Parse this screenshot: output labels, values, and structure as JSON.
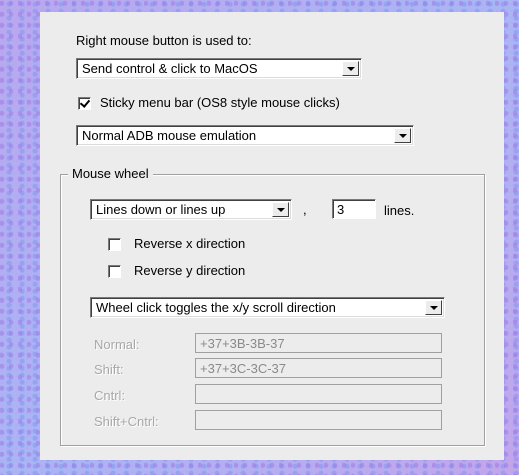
{
  "right_mouse": {
    "label": "Right mouse button is used to:",
    "selected": "Send control & click to MacOS"
  },
  "sticky_menu": {
    "checked": true,
    "label": "Sticky menu bar (OS8 style mouse clicks)"
  },
  "adb_emulation": {
    "selected": "Normal ADB mouse emulation"
  },
  "mouse_wheel": {
    "title": "Mouse wheel",
    "mode_selected": "Lines down or lines up",
    "comma": ",",
    "lines_value": "3",
    "lines_label": "lines.",
    "reverse_x": {
      "checked": false,
      "label": "Reverse x direction"
    },
    "reverse_y": {
      "checked": false,
      "label": "Reverse y direction"
    },
    "click_selected": "Wheel click toggles the x/y scroll direction",
    "rows": [
      {
        "label": "Normal:",
        "value": "+37+3B-3B-37"
      },
      {
        "label": "Shift:",
        "value": "+37+3C-3C-37"
      },
      {
        "label": "Cntrl:",
        "value": ""
      },
      {
        "label": "Shift+Cntrl:",
        "value": ""
      }
    ]
  }
}
